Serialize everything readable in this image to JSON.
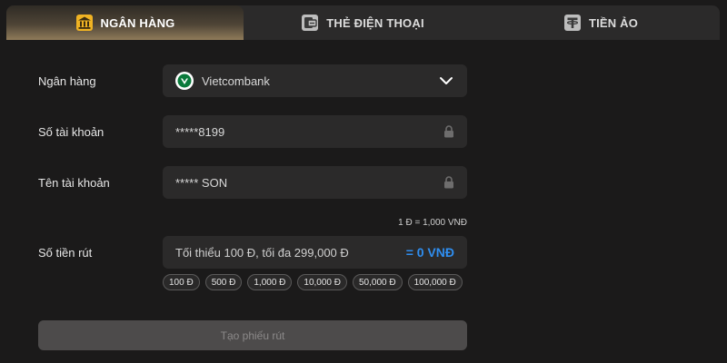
{
  "tabs": [
    {
      "label": "NGÂN HÀNG",
      "icon": "bank-icon",
      "active": true
    },
    {
      "label": "THẺ ĐIỆN THOẠI",
      "icon": "phone-card-icon",
      "active": false
    },
    {
      "label": "TIỀN ẢO",
      "icon": "tether-icon",
      "active": false
    }
  ],
  "form": {
    "bank_label": "Ngân hàng",
    "bank_value": "Vietcombank",
    "account_number_label": "Số tài khoản",
    "account_number_value": "*****8199",
    "account_name_label": "Tên tài khoản",
    "account_name_value": "***** SON",
    "exchange_rate": "1 Đ = 1,000 VNĐ",
    "amount_label": "Số tiền rút",
    "amount_placeholder": "Tối thiểu 100 Đ, tối đa 299,000 Đ",
    "amount_conversion": "= 0 VNĐ",
    "quick_amounts": [
      "100 Đ",
      "500 Đ",
      "1,000 Đ",
      "10,000 Đ",
      "50,000 Đ",
      "100,000 Đ"
    ],
    "submit_label": "Tạo phiếu rút"
  },
  "colors": {
    "background": "#1b1a1a",
    "field": "#2b2a2a",
    "accent_blue": "#2f8ef0",
    "active_tab_gold": "#8f7b59",
    "disabled_button": "#4d4b4b"
  }
}
